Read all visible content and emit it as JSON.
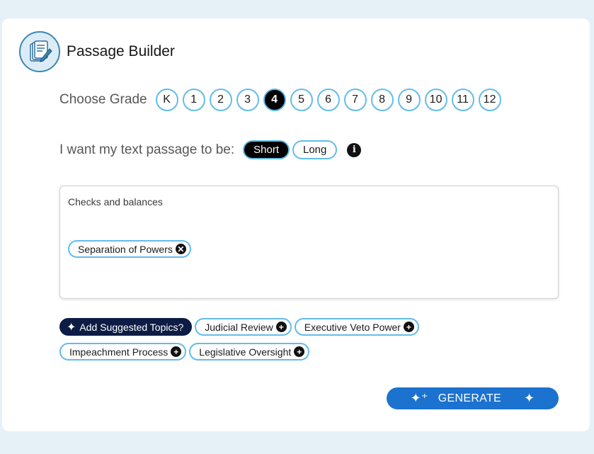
{
  "app": {
    "title": "Passage Builder",
    "logo_icon": "notebook-pencil-icon"
  },
  "grades": {
    "label": "Choose Grade",
    "options": [
      "K",
      "1",
      "2",
      "3",
      "4",
      "5",
      "6",
      "7",
      "8",
      "9",
      "10",
      "11",
      "12"
    ],
    "selected": "4"
  },
  "length": {
    "label": "I want my text passage to be:",
    "options": [
      "Short",
      "Long"
    ],
    "selected": "Short",
    "info_icon": "i"
  },
  "topic": {
    "value": "Checks and balances",
    "chips": [
      {
        "label": "Separation of Powers",
        "icon": "remove-icon"
      }
    ]
  },
  "suggestions": {
    "button_label": "Add Suggested Topics?",
    "items": [
      {
        "label": "Judicial Review",
        "icon": "add-icon"
      },
      {
        "label": "Executive Veto Power",
        "icon": "add-icon"
      },
      {
        "label": "Impeachment Process",
        "icon": "add-icon"
      },
      {
        "label": "Legislative Oversight",
        "icon": "add-icon"
      }
    ]
  },
  "generate": {
    "label": "GENERATE"
  },
  "colors": {
    "accent": "#63bcea",
    "primary_button": "#1c72cf",
    "dark_chip": "#0d1c45",
    "background": "#e6f1f7"
  }
}
